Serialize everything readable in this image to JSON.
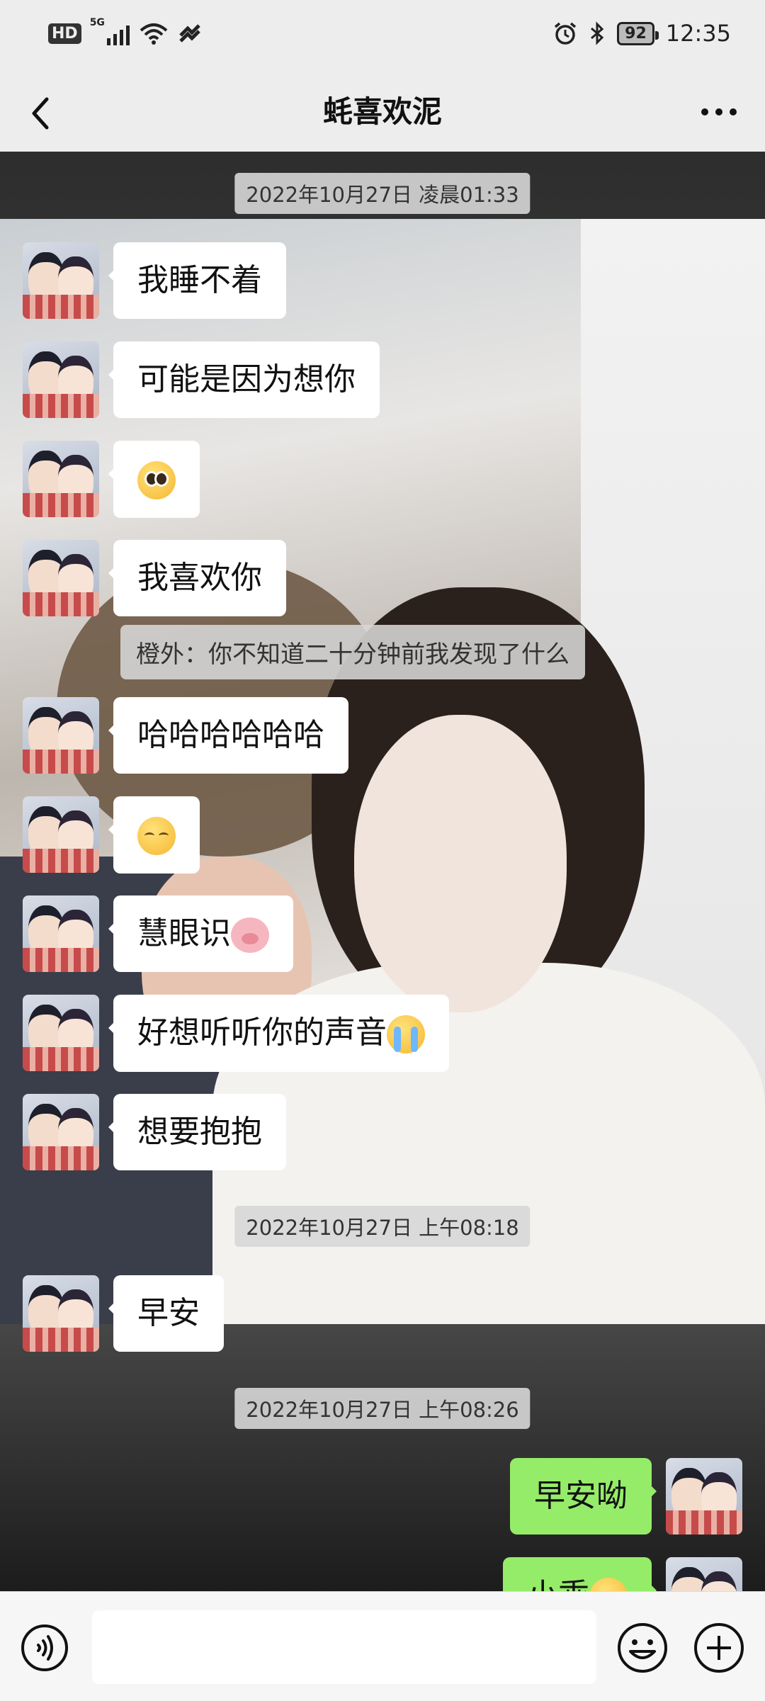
{
  "status_bar": {
    "hd": "HD",
    "network": "5G",
    "battery": "92",
    "time": "12:35"
  },
  "header": {
    "title": "蚝喜欢泥"
  },
  "messages": [
    {
      "type": "timestamp",
      "text": "2022年10月27日 凌晨01:33"
    },
    {
      "type": "received",
      "text": "我睡不着"
    },
    {
      "type": "received",
      "text": "可能是因为想你"
    },
    {
      "type": "received",
      "emoji": "pleading-face-emoji"
    },
    {
      "type": "received",
      "text": "我喜欢你"
    },
    {
      "type": "quote",
      "text": "橙外：你不知道二十分钟前我发现了什么"
    },
    {
      "type": "received",
      "text": "哈哈哈哈哈哈"
    },
    {
      "type": "received",
      "emoji": "shy-face-emoji"
    },
    {
      "type": "received",
      "text": "慧眼识",
      "emoji": "pig-face-emoji"
    },
    {
      "type": "received",
      "text": "好想听听你的声音",
      "emoji": "loudly-crying-emoji"
    },
    {
      "type": "received",
      "text": "想要抱抱"
    },
    {
      "type": "timestamp",
      "text": "2022年10月27日 上午08:18"
    },
    {
      "type": "received",
      "text": "早安"
    },
    {
      "type": "timestamp",
      "text": "2022年10月27日 上午08:26"
    },
    {
      "type": "sent",
      "text": "早安呦"
    },
    {
      "type": "sent",
      "text": "小乖",
      "emoji": "smiley-emoji",
      "partial": true
    }
  ],
  "input_bar": {
    "voice_icon": "voice-icon",
    "emoji_icon": "emoji-icon",
    "plus_icon": "plus-icon"
  },
  "colors": {
    "sent_bubble": "#95ec69",
    "received_bubble": "#ffffff",
    "bar_background": "#ededed"
  }
}
